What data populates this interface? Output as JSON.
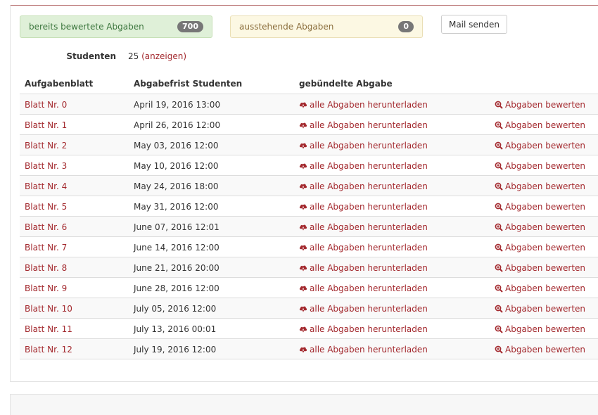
{
  "stats": {
    "graded": {
      "label": "bereits bewertete Abgaben",
      "count": "700"
    },
    "pending": {
      "label": "ausstehende Abgaben",
      "count": "0"
    }
  },
  "mail_button": "Mail senden",
  "students": {
    "label": "Studenten",
    "count": "25",
    "show_link": "(anzeigen)"
  },
  "table": {
    "headers": {
      "sheet": "Aufgabenblatt",
      "deadline": "Abgabefrist Studenten",
      "bundled": "gebündelte Abgabe"
    },
    "rows": [
      {
        "sheet": "Blatt Nr. 0",
        "deadline": "April 19, 2016 13:00",
        "download": "alle Abgaben herunterladen",
        "grade": "Abgaben bewerten"
      },
      {
        "sheet": "Blatt Nr. 1",
        "deadline": "April 26, 2016 12:00",
        "download": "alle Abgaben herunterladen",
        "grade": "Abgaben bewerten"
      },
      {
        "sheet": "Blatt Nr. 2",
        "deadline": "May 03, 2016 12:00",
        "download": "alle Abgaben herunterladen",
        "grade": "Abgaben bewerten"
      },
      {
        "sheet": "Blatt Nr. 3",
        "deadline": "May 10, 2016 12:00",
        "download": "alle Abgaben herunterladen",
        "grade": "Abgaben bewerten"
      },
      {
        "sheet": "Blatt Nr. 4",
        "deadline": "May 24, 2016 18:00",
        "download": "alle Abgaben herunterladen",
        "grade": "Abgaben bewerten"
      },
      {
        "sheet": "Blatt Nr. 5",
        "deadline": "May 31, 2016 12:00",
        "download": "alle Abgaben herunterladen",
        "grade": "Abgaben bewerten"
      },
      {
        "sheet": "Blatt Nr. 6",
        "deadline": "June 07, 2016 12:01",
        "download": "alle Abgaben herunterladen",
        "grade": "Abgaben bewerten"
      },
      {
        "sheet": "Blatt Nr. 7",
        "deadline": "June 14, 2016 12:00",
        "download": "alle Abgaben herunterladen",
        "grade": "Abgaben bewerten"
      },
      {
        "sheet": "Blatt Nr. 8",
        "deadline": "June 21, 2016 20:00",
        "download": "alle Abgaben herunterladen",
        "grade": "Abgaben bewerten"
      },
      {
        "sheet": "Blatt Nr. 9",
        "deadline": "June 28, 2016 12:00",
        "download": "alle Abgaben herunterladen",
        "grade": "Abgaben bewerten"
      },
      {
        "sheet": "Blatt Nr. 10",
        "deadline": "July 05, 2016 12:00",
        "download": "alle Abgaben herunterladen",
        "grade": "Abgaben bewerten"
      },
      {
        "sheet": "Blatt Nr. 11",
        "deadline": "July 13, 2016 00:01",
        "download": "alle Abgaben herunterladen",
        "grade": "Abgaben bewerten"
      },
      {
        "sheet": "Blatt Nr. 12",
        "deadline": "July 19, 2016 12:00",
        "download": "alle Abgaben herunterladen",
        "grade": "Abgaben bewerten"
      }
    ]
  },
  "colors": {
    "link": "#a3292e",
    "graded_bg": "#dff0d8",
    "pending_bg": "#fcf8e3",
    "badge": "#777777"
  },
  "icons": {
    "download": "cloud-download-icon",
    "grade": "zoom-in-icon"
  }
}
